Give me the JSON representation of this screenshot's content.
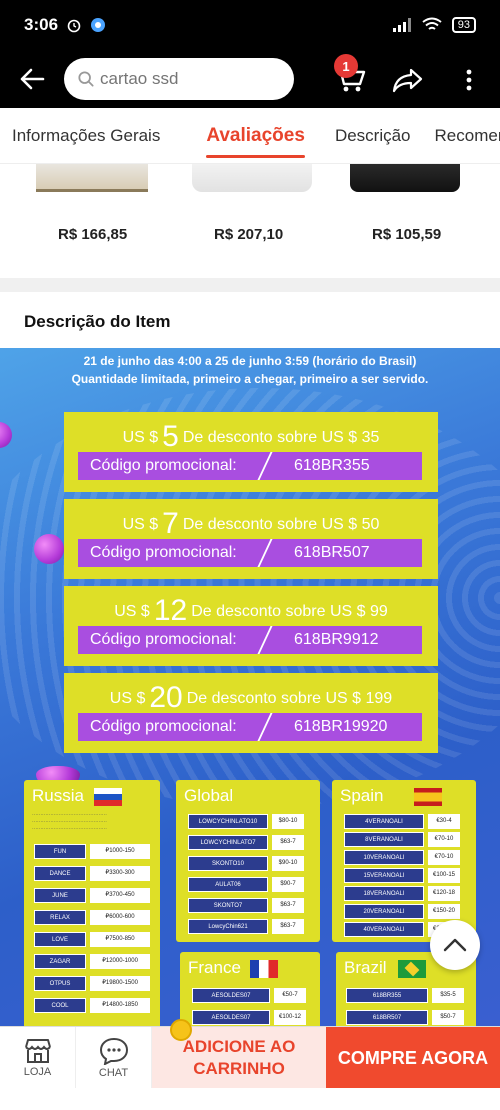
{
  "status_bar": {
    "time": "3:06",
    "battery": "93"
  },
  "search": {
    "placeholder": "cartao ssd"
  },
  "cart": {
    "badge_count": "1"
  },
  "tabs": [
    {
      "label": "Informações Gerais"
    },
    {
      "label": "Avaliações"
    },
    {
      "label": "Descrição"
    },
    {
      "label": "Recomend"
    }
  ],
  "products": [
    {
      "price": "R$ 166,85"
    },
    {
      "price": "R$ 207,10"
    },
    {
      "price": "R$ 105,59"
    }
  ],
  "description": {
    "title": "Descrição do Item"
  },
  "promo": {
    "line1": "21 de junho das 4:00 a 25 de junho 3:59 (horário do Brasil)",
    "line2": "Quantidade limitada, primeiro a chegar, primeiro a ser servido.",
    "coupons": [
      {
        "prefix": "US $",
        "amount": "5",
        "suffix": "De desconto sobre US $ 35",
        "code_label": "Código promocional:",
        "code": "618BR355"
      },
      {
        "prefix": "US $",
        "amount": "7",
        "suffix": "De desconto sobre US $ 50",
        "code_label": "Código promocional:",
        "code": "618BR507"
      },
      {
        "prefix": "US $",
        "amount": "12",
        "suffix": "De desconto sobre US $ 99",
        "code_label": "Código promocional:",
        "code": "618BR9912"
      },
      {
        "prefix": "US $",
        "amount": "20",
        "suffix": "De desconto sobre US $ 199",
        "code_label": "Código promocional:",
        "code": "618BR19920"
      }
    ],
    "countries": {
      "russia": {
        "name": "Russia",
        "rows": [
          [
            "FUN",
            "₽1000-150"
          ],
          [
            "DANCE",
            "₽3300-300"
          ],
          [
            "JUNE",
            "₽3700-450"
          ],
          [
            "RELAX",
            "₽6000-600"
          ],
          [
            "LOVE",
            "₽7500-850"
          ],
          [
            "ZAGAR",
            "₽12000-1000"
          ],
          [
            "OTPUS",
            "₽19800-1500"
          ],
          [
            "COOL",
            "₽14800-1850"
          ]
        ]
      },
      "global": {
        "name": "Global",
        "rows": [
          [
            "LOWCYCHINLATO10",
            "$80-10"
          ],
          [
            "LOWCYCHINLATO7",
            "$63-7"
          ],
          [
            "SKONTO10",
            "$90-10"
          ],
          [
            "AULAT06",
            "$90-7"
          ],
          [
            "SKONTO7",
            "$63-7"
          ],
          [
            "LowcyChin621",
            "$63-7"
          ]
        ]
      },
      "spain": {
        "name": "Spain",
        "rows": [
          [
            "4VERANOALI",
            "€30-4"
          ],
          [
            "8VERANOALI",
            "€70-10"
          ],
          [
            "10VERANOALI",
            "€70-10"
          ],
          [
            "15VERANOALI",
            "€100-15"
          ],
          [
            "18VERANOALI",
            "€120-18"
          ],
          [
            "20VERANOALI",
            "€150-20"
          ],
          [
            "40VERANOALI",
            "€290-40"
          ]
        ]
      },
      "france": {
        "name": "France",
        "rows": [
          [
            "AESOLDES07",
            "€50-7"
          ],
          [
            "AESOLDES07",
            "€100-12"
          ]
        ]
      },
      "brazil": {
        "name": "Brazil",
        "rows": [
          [
            "618BR355",
            "$35-5"
          ],
          [
            "618BR507",
            "$50-7"
          ]
        ]
      }
    }
  },
  "bottom_bar": {
    "store_label": "LOJA",
    "chat_label": "CHAT",
    "add_to_cart_line1": "ADICIONE AO",
    "add_to_cart_line2": "CARRINHO",
    "buy_now": "COMPRE AGORA"
  }
}
